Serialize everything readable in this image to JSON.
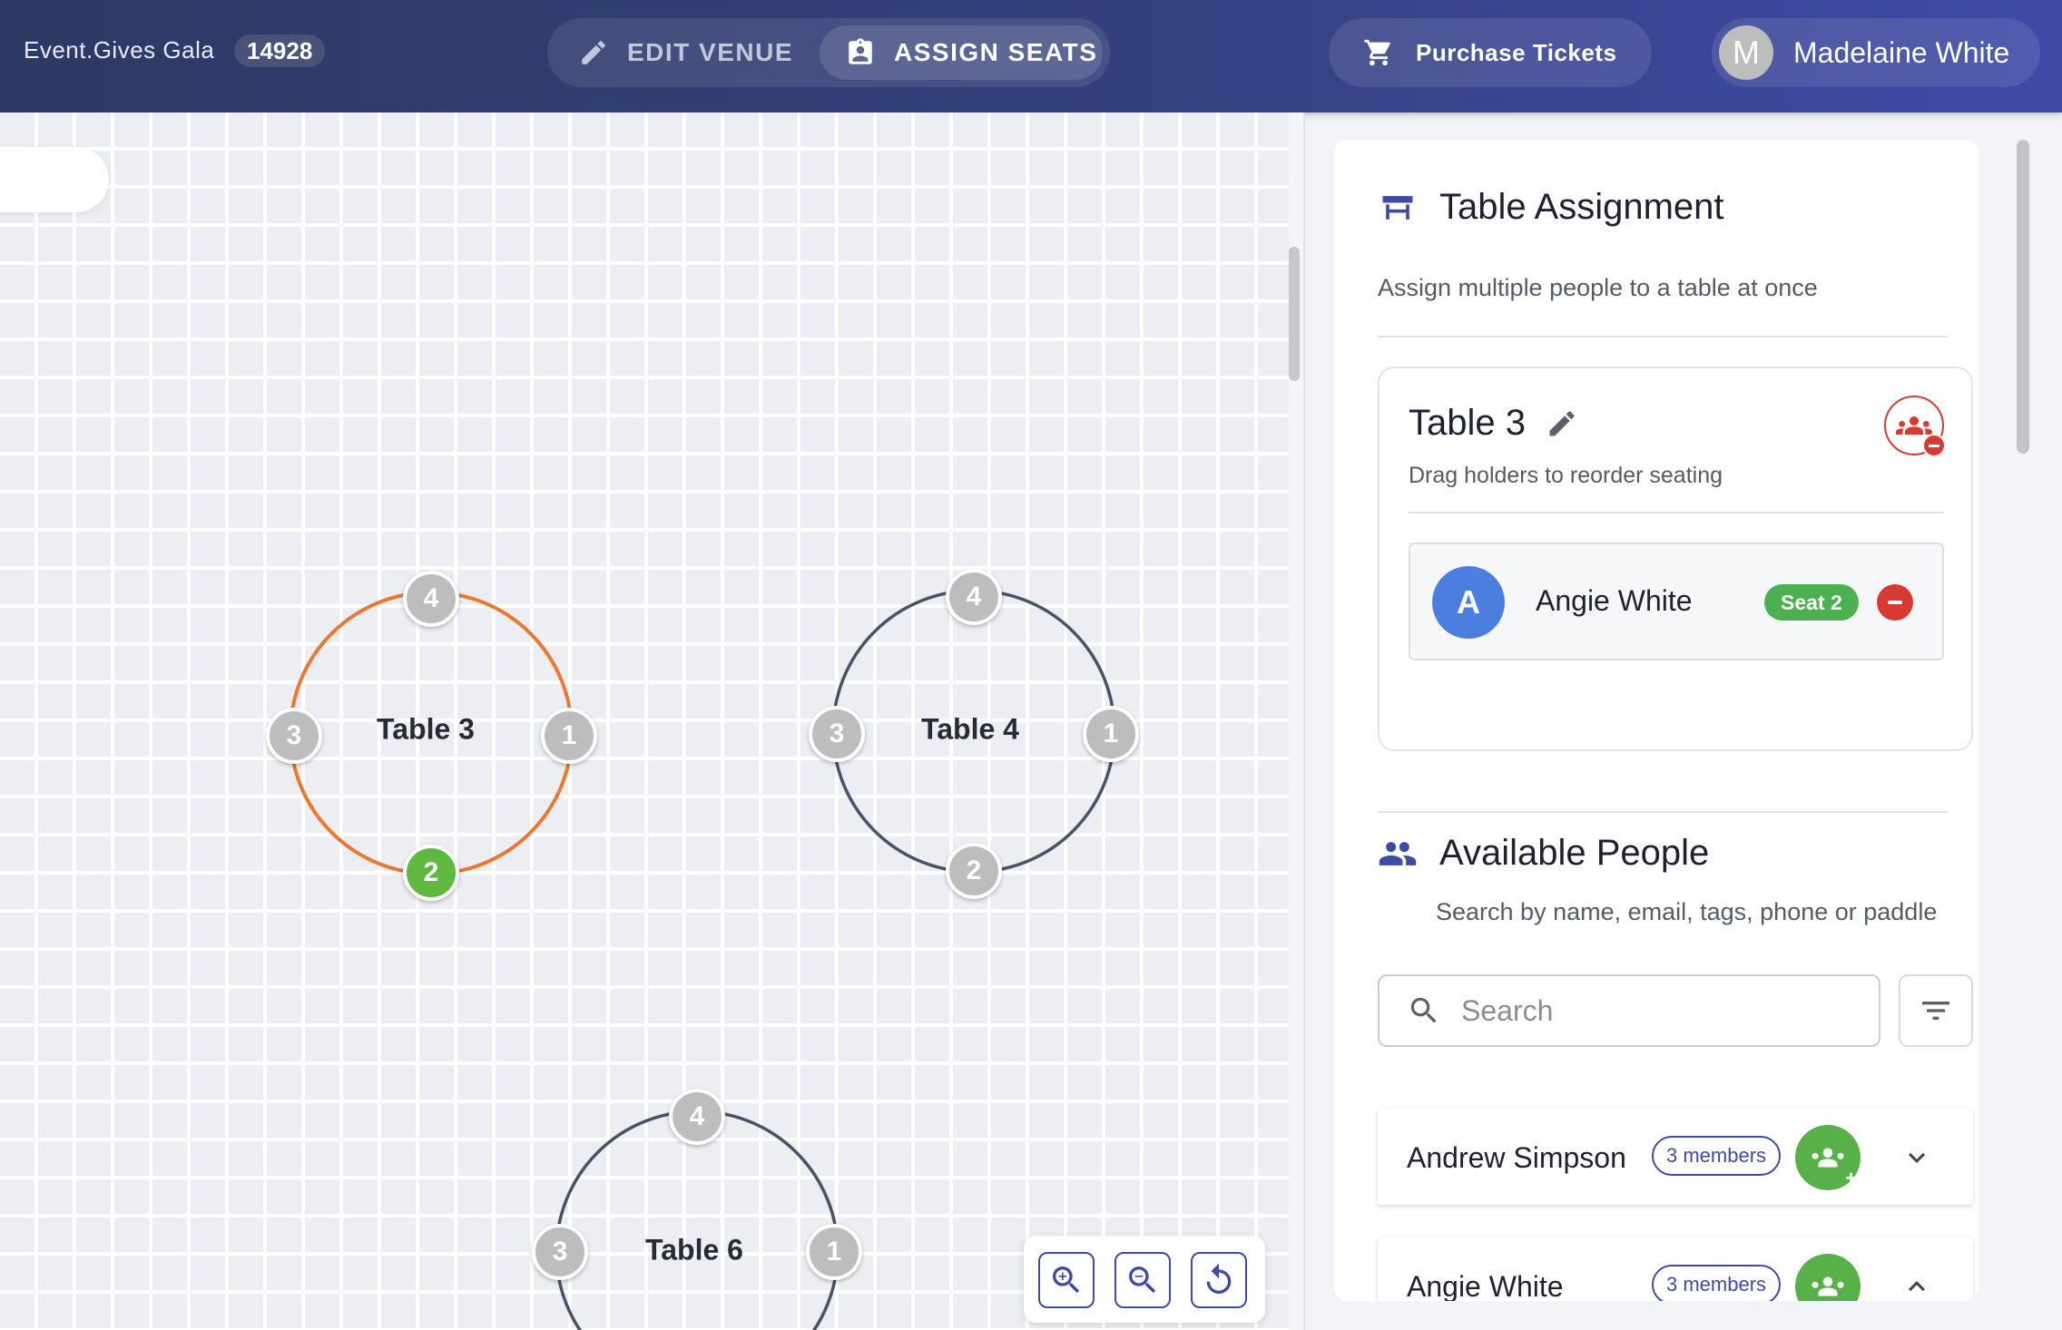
{
  "topbar": {
    "brand": "Event.Gives Gala",
    "event_id": "14928",
    "modes": [
      {
        "label": "EDIT VENUE",
        "icon": "pencil-icon",
        "active": false
      },
      {
        "label": "ASSIGN SEATS",
        "icon": "assignment-ind-icon",
        "active": true
      }
    ],
    "purchase_label": "Purchase Tickets",
    "user": {
      "initial": "M",
      "name": "Madelaine White"
    }
  },
  "canvas": {
    "tables": [
      {
        "label": "Table 3",
        "selected": true,
        "seats": [
          "4",
          "3",
          "1",
          "2"
        ],
        "taken_seat": "2"
      },
      {
        "label": "Table 4",
        "selected": false,
        "seats": [
          "4",
          "3",
          "1",
          "2"
        ]
      },
      {
        "label": "Table 6",
        "selected": false,
        "seats": [
          "4",
          "3",
          "1"
        ]
      }
    ],
    "colors": {
      "selected_ring": "#e8792f",
      "ring": "#4a5266",
      "seat": "#bdbdbd",
      "seat_taken": "#5fb840"
    },
    "zoom_controls": [
      "zoom-in-icon",
      "zoom-out-icon",
      "reset-icon"
    ]
  },
  "sidebar": {
    "assignment": {
      "title": "Table Assignment",
      "subtitle": "Assign multiple people to a table at once",
      "table": {
        "name": "Table 3",
        "hint": "Drag holders to reorder seating",
        "holders": [
          {
            "initial": "A",
            "name": "Angie White",
            "seat": "Seat 2"
          }
        ]
      }
    },
    "people": {
      "title": "Available People",
      "subtitle": "Search by name, email, tags, phone or paddle",
      "search_placeholder": "Search",
      "list": [
        {
          "name": "Andrew Simpson",
          "members": "3 members",
          "expanded": false
        },
        {
          "name": "Angie White",
          "members": "3 members",
          "expanded": true
        }
      ]
    },
    "colors": {
      "accent": "#3f4aa7",
      "success": "#4caf50",
      "danger": "#d63a32"
    }
  }
}
